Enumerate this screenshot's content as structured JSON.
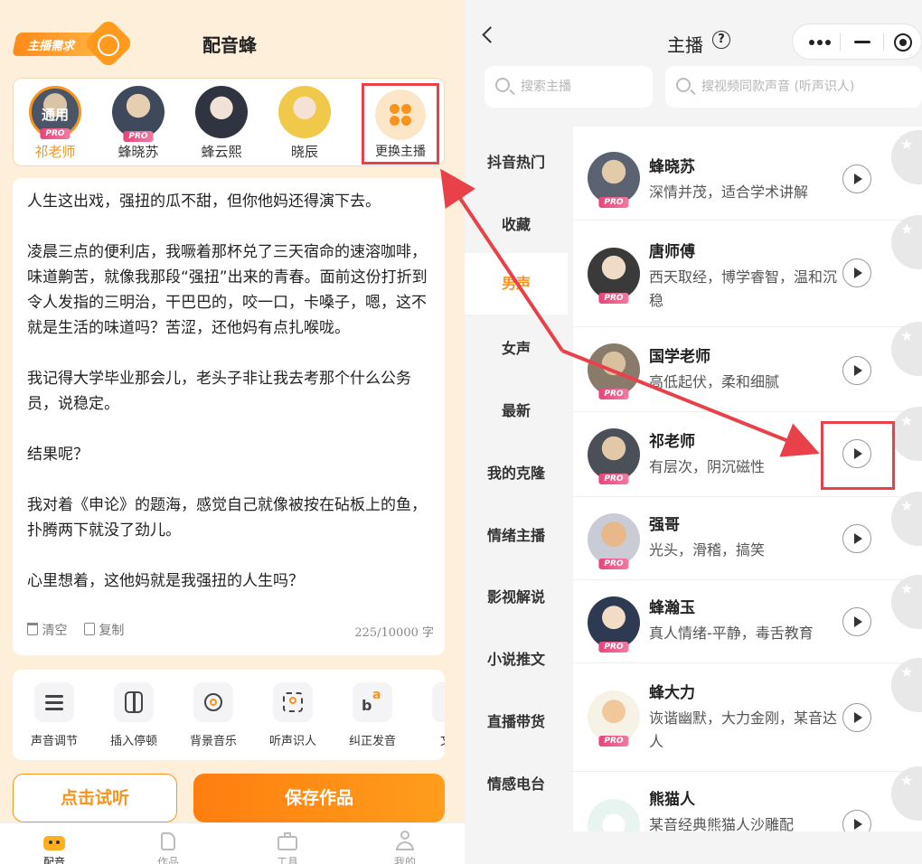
{
  "left": {
    "badge": "主播需求",
    "app_title": "配音蜂",
    "anchors": [
      {
        "name": "祁老师",
        "overlay": "通用",
        "pro": "PRO",
        "selected": true
      },
      {
        "name": "蜂晓苏",
        "overlay": "",
        "pro": "PRO",
        "selected": false
      },
      {
        "name": "蜂云熙",
        "overlay": "",
        "pro": "",
        "selected": false
      },
      {
        "name": "晓辰",
        "overlay": "",
        "pro": "",
        "selected": false
      }
    ],
    "change_anchor": "更换主播",
    "paragraphs": [
      "人生这出戏，强扭的瓜不甜，但你他妈还得演下去。",
      " 凌晨三点的便利店，我噘着那杯兑了三天宿命的速溶咖啡，味道齁苦，就像我那段“强扭”出来的青春。面前这份打折到令人发指的三明治，干巴巴的，咬一口，卡嗓子，嗯，这不就是生活的味道吗？苦涩，还他妈有点扎喉咙。",
      " 我记得大学毕业那会儿，老头子非让我去考那个什么公务员，说稳定。",
      "结果呢？",
      "我对着《申论》的题海，感觉自己就像被按在砧板上的鱼，扑腾两下就没了劲儿。",
      "心里想着，这他妈就是我强扭的人生吗？"
    ],
    "clear_label": "清空",
    "copy_label": "复制",
    "char_count": "225/10000 字",
    "tools": [
      "声音调节",
      "插入停顿",
      "背景音乐",
      "听声识人",
      "纠正发音",
      "文案"
    ],
    "try_button": "点击试听",
    "save_button": "保存作品",
    "tabs": [
      "配音",
      "作品",
      "工具",
      "我的"
    ]
  },
  "right": {
    "title": "主播",
    "help": "?",
    "search_anchor_placeholder": "搜索主播",
    "search_voice_placeholder": "搜视频同款声音 (听声识人)",
    "categories": [
      "抖音热门",
      "收藏",
      "男声",
      "女声",
      "最新",
      "我的克隆",
      "情绪主播",
      "影视解说",
      "小说推文",
      "直播带货",
      "情感电台"
    ],
    "active_category": "男声",
    "voices": [
      {
        "name": "蜂晓苏",
        "desc": "深情并茂，适合学术讲解",
        "pro": "PRO"
      },
      {
        "name": "唐师傅",
        "desc": "西天取经，博学睿智，温和沉稳",
        "pro": "PRO"
      },
      {
        "name": "国学老师",
        "desc": "高低起伏，柔和细腻",
        "pro": "PRO"
      },
      {
        "name": "祁老师",
        "desc": "有层次，阴沉磁性",
        "pro": "PRO"
      },
      {
        "name": "强哥",
        "desc": "光头，滑稽，搞笑",
        "pro": "PRO"
      },
      {
        "name": "蜂瀚玉",
        "desc": "真人情绪-平静，毒舌教育",
        "pro": "PRO"
      },
      {
        "name": "蜂大力",
        "desc": "诙谐幽默，大力金刚，某音达人",
        "pro": "PRO"
      },
      {
        "name": "熊猫人",
        "desc": "某音经典熊猫人沙雕配",
        "pro": ""
      }
    ]
  },
  "colors": {
    "accent": "#f7941d",
    "highlight": "#e8414a",
    "pro": "#e8447a"
  }
}
